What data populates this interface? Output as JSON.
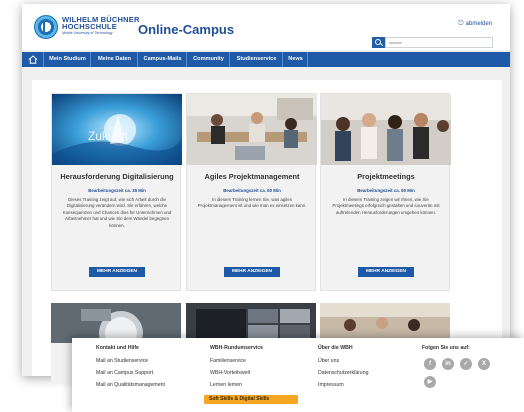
{
  "header": {
    "brand_line1": "WILHELM BÜCHNER",
    "brand_line2": "HOCHSCHULE",
    "brand_tagline": "Mobile University of Technology",
    "campus_title": "Online-Campus",
    "logout_label": "abmelden",
    "search_placeholder": "suchen"
  },
  "nav": {
    "items": [
      "Mein Studium",
      "Meine Daten",
      "Campus-Mails",
      "Community",
      "Studienservice",
      "News"
    ]
  },
  "cards": [
    {
      "title": "Herausforderung Digitalisierung",
      "time": "Bearbeitungszeit ca. 35 Min",
      "description": "Dieses Training zeigt auf, wie sich Arbeit durch die Digitalisierung verändern wird. Sie erfahren, welche Konsequenzen und Chancen dies für Unternehmen und Arbeitnehmer hat und wie Sie dem Wandel begegnen können.",
      "button": "MEHR ANZEIGEN",
      "image_overlay": "Zukunft"
    },
    {
      "title": "Agiles Projektmanagement",
      "time": "Bearbeitungszeit ca. 60 Min",
      "description": "In diesem Training lernen Sie, was agiles Projektmanagement ist und wie man es einsetzen kann.",
      "button": "MEHR ANZEIGEN"
    },
    {
      "title": "Projektmeetings",
      "time": "Bearbeitungszeit ca. 60 Min",
      "description": "In diesem Training zeigen wir Ihnen, wie Sie Projektmeetings erfolgreich gestalten und souverän mit auftretenden Herausforderungen umgehen können.",
      "button": "MEHR ANZEIGEN"
    }
  ],
  "footer": {
    "col1": {
      "heading": "Kontakt und Hilfe",
      "links": [
        "Mail an Studienservice",
        "Mail an Campus Support",
        "Mail an Qualitätsmanagement"
      ]
    },
    "col2": {
      "heading": "WBH-Rundumservice",
      "links": [
        "Familienservice",
        "WBH-Vorteilswelt",
        "Lernen lernen"
      ],
      "highlight": "Soft Skills & Digital Skills"
    },
    "col3": {
      "heading": "Über die WBH",
      "links": [
        "Über uns",
        "Datenschutzerklärung",
        "Impressum"
      ]
    },
    "col4": {
      "heading": "Folgen Sie uns auf:"
    },
    "social_icons": [
      "facebook-icon",
      "linkedin-icon",
      "twitter-icon",
      "xing-icon",
      "youtube-icon"
    ]
  },
  "colors": {
    "brand_blue": "#1f4f96",
    "nav_blue": "#1e5aa8",
    "highlight": "#f5a623",
    "card_bg": "#f2f2f2"
  }
}
